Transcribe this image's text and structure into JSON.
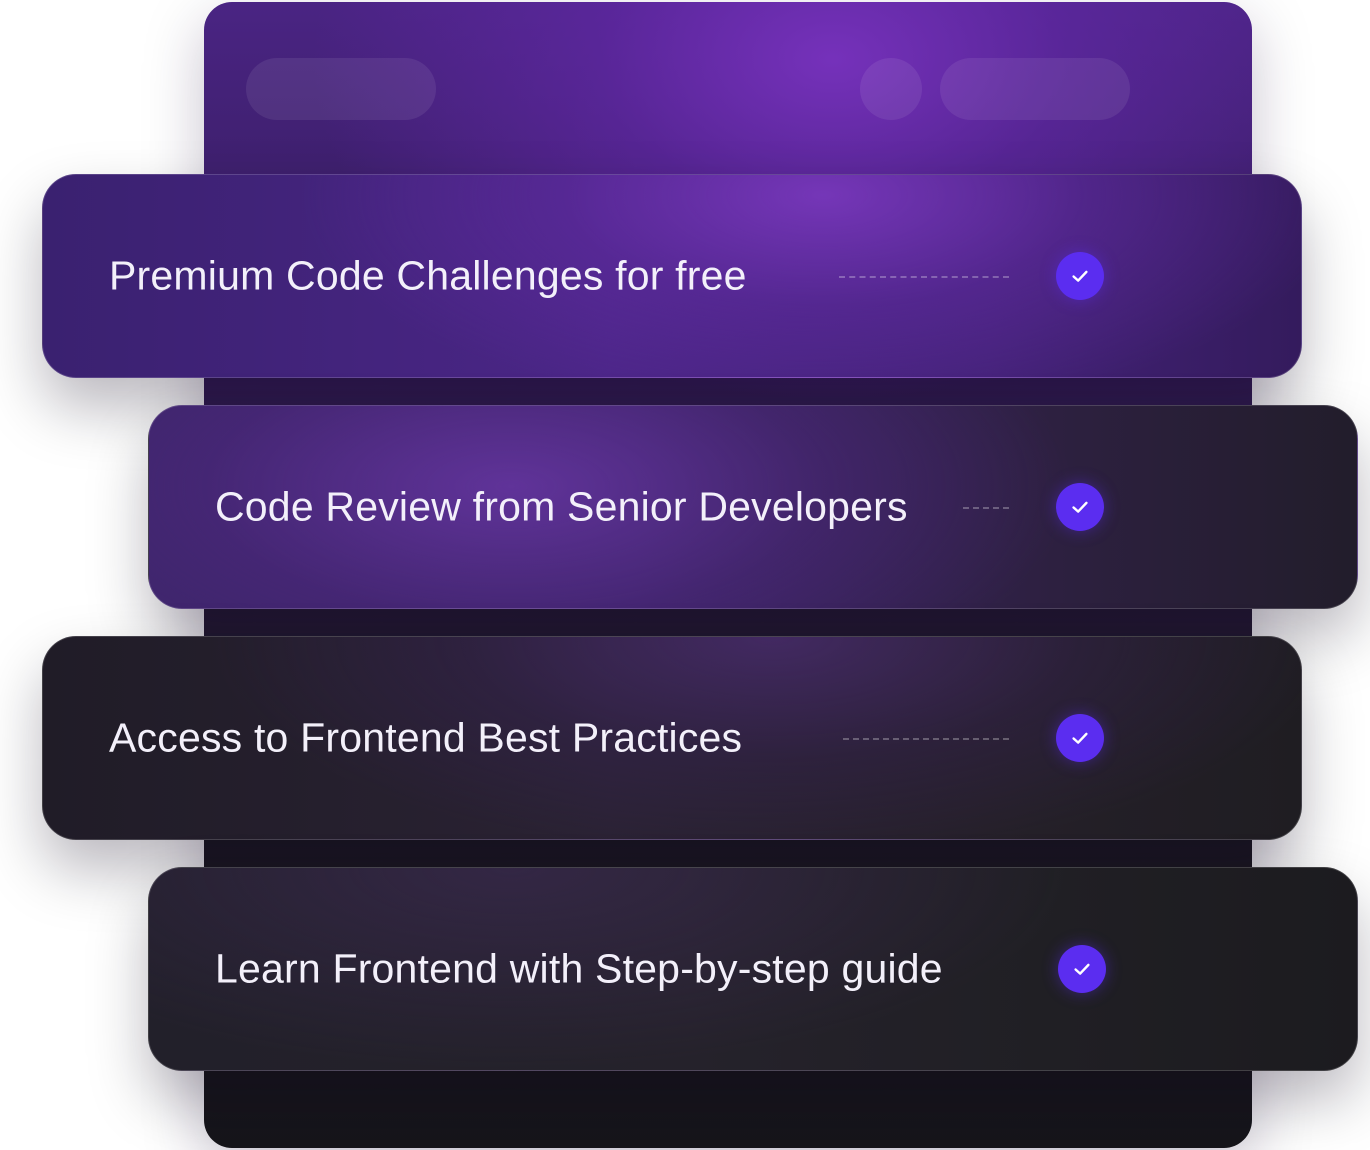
{
  "features": [
    {
      "label": "Premium Code Challenges for free",
      "checked": true
    },
    {
      "label": "Code Review from Senior Developers",
      "checked": true
    },
    {
      "label": "Access to Frontend Best Practices",
      "checked": true
    },
    {
      "label": "Learn Frontend with Step-by-step guide",
      "checked": true
    }
  ],
  "colors": {
    "accent": "#5b2df0",
    "brand_purple": "#6b2aa8",
    "text": "#f3f0fa"
  },
  "icons": {
    "check": "check-icon"
  }
}
